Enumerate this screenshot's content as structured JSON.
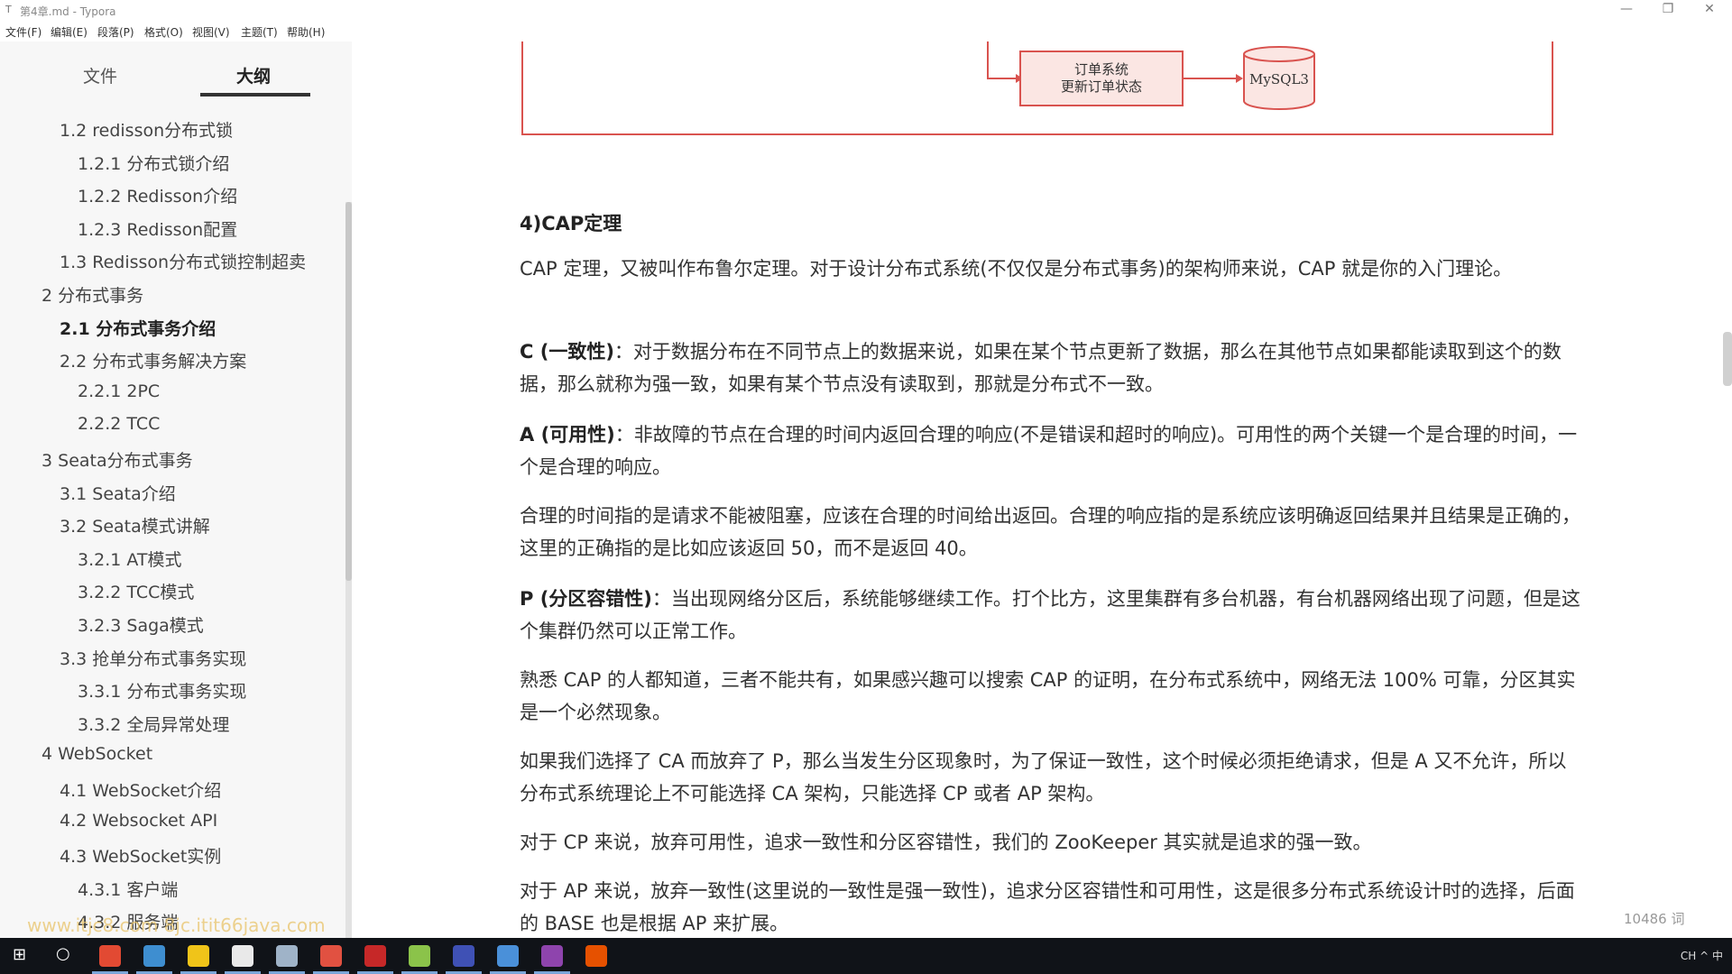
{
  "window": {
    "title": "第4章.md - Typora",
    "controls": [
      "—",
      "❐",
      "✕"
    ]
  },
  "menu": [
    "文件(F)",
    "编辑(E)",
    "段落(P)",
    "格式(O)",
    "视图(V)",
    "主题(T)",
    "帮助(H)"
  ],
  "sidebar": {
    "tabs": [
      "文件",
      "大纲"
    ],
    "active_tab": "大纲",
    "outline": [
      {
        "text": "1.2 redisson分布式锁",
        "level": 2
      },
      {
        "text": "1.2.1 分布式锁介绍",
        "level": 3
      },
      {
        "text": "1.2.2 Redisson介绍",
        "level": 3
      },
      {
        "text": "1.2.3 Redisson配置",
        "level": 3
      },
      {
        "text": "1.3 Redisson分布式锁控制超卖",
        "level": 2
      },
      {
        "text": "2 分布式事务",
        "level": 1
      },
      {
        "text": "2.1 分布式事务介绍",
        "level": 2,
        "active": true
      },
      {
        "text": "2.2 分布式事务解决方案",
        "level": 2
      },
      {
        "text": "2.2.1 2PC",
        "level": 3
      },
      {
        "text": "2.2.2 TCC",
        "level": 3
      },
      {
        "text": "3 Seata分布式事务",
        "level": 1
      },
      {
        "text": "3.1 Seata介绍",
        "level": 2
      },
      {
        "text": "3.2 Seata模式讲解",
        "level": 2
      },
      {
        "text": "3.2.1 AT模式",
        "level": 3
      },
      {
        "text": "3.2.2 TCC模式",
        "level": 3
      },
      {
        "text": "3.2.3 Saga模式",
        "level": 3
      },
      {
        "text": "3.3 抢单分布式事务实现",
        "level": 2
      },
      {
        "text": "3.3.1 分布式事务实现",
        "level": 3
      },
      {
        "text": "3.3.2 全局异常处理",
        "level": 3
      },
      {
        "text": "4 WebSocket",
        "level": 1
      },
      {
        "text": "4.1 WebSocket介绍",
        "level": 2
      },
      {
        "text": "4.2 Websocket API",
        "level": 2
      },
      {
        "text": "4.3 WebSocket实例",
        "level": 2
      },
      {
        "text": "4.3.1 客户端",
        "level": 3
      },
      {
        "text": "4.3.2 服务端",
        "level": 3
      }
    ],
    "watermark": "www.itjc8.com  8jc.itit66java.com",
    "footer_left": "<",
    "footer_code": "</>"
  },
  "diagram": {
    "order_box_line1": "订单系统",
    "order_box_line2": "更新订单状态",
    "db_label": "MySQL3"
  },
  "content": {
    "heading": "4)CAP定理",
    "p1": "CAP 定理，又被叫作布鲁尔定理。对于设计分布式系统(不仅仅是分布式事务)的架构师来说，CAP 就是你的入门理论。",
    "c_label": "C (一致性)",
    "c_text": "：对于数据分布在不同节点上的数据来说，如果在某个节点更新了数据，那么在其他节点如果都能读取到这个的数据，那么就称为强一致，如果有某个节点没有读取到，那就是分布式不一致。",
    "a_label": "A (可用性)",
    "a_text": "：非故障的节点在合理的时间内返回合理的响应(不是错误和超时的响应)。可用性的两个关键一个是合理的时间，一个是合理的响应。",
    "p_time": "合理的时间指的是请求不能被阻塞，应该在合理的时间给出返回。合理的响应指的是系统应该明确返回结果并且结果是正确的，这里的正确指的是比如应该返回 50，而不是返回 40。",
    "p_label": "P (分区容错性)",
    "p_text": "：当出现网络分区后，系统能够继续工作。打个比方，这里集群有多台机器，有台机器网络出现了问题，但是这个集群仍然可以正常工作。",
    "p_familiar": "熟悉 CAP 的人都知道，三者不能共有，如果感兴趣可以搜索 CAP 的证明，在分布式系统中，网络无法 100% 可靠，分区其实是一个必然现象。",
    "p_ca": "如果我们选择了 CA 而放弃了 P，那么当发生分区现象时，为了保证一致性，这个时候必须拒绝请求，但是 A 又不允许，所以分布式系统理论上不可能选择 CA 架构，只能选择 CP 或者 AP 架构。",
    "p_cp": "对于 CP 来说，放弃可用性，追求一致性和分区容错性，我们的 ZooKeeper 其实就是追求的强一致。",
    "p_ap": "对于 AP 来说，放弃一致性(这里说的一致性是强一致性)，追求分区容错性和可用性，这是很多分布式系统设计时的选择，后面的 BASE 也是根据 AP 来扩展。"
  },
  "status": {
    "word_count": "10486 词"
  },
  "taskbar": {
    "tray": "CH  ^  中  ",
    "colors": [
      "#e24a33",
      "#3e8ed0",
      "#f0c419",
      "#e9e9e9",
      "#9fb3c8",
      "#e15141",
      "#c62828",
      "#8bc34a",
      "#3f51b5",
      "#4a90d9",
      "#8e44ad",
      "#e65100"
    ]
  }
}
